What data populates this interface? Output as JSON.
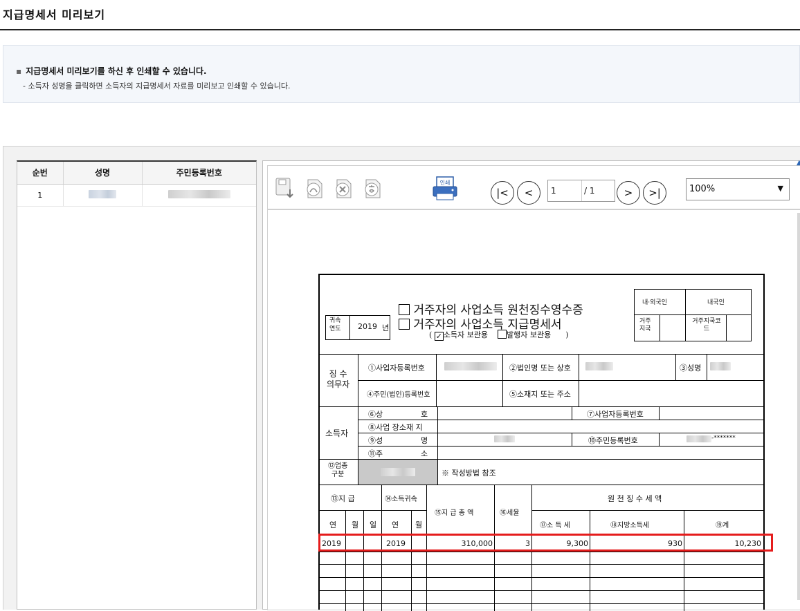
{
  "page": {
    "title": "지급명세서 미리보기"
  },
  "notice": {
    "bullet": "▪",
    "main": "지급명세서 미리보기를 하신 후 인쇄할 수 있습니다.",
    "sub": "- 소득자 성명을 클릭하면 소득자의 지급명세서 자료를 미리보고 인쇄할 수 있습니다."
  },
  "list": {
    "headers": [
      "순번",
      "성명",
      "주민등록번호"
    ],
    "rows": [
      {
        "no": "1",
        "name": "",
        "rrn": ""
      }
    ]
  },
  "toolbar": {
    "icons": [
      "save-icon",
      "pdf-icon",
      "excel-icon",
      "hwp-icon",
      "print-icon"
    ],
    "print_label": "인쇄",
    "first": "|<",
    "prev": "<",
    "next": ">",
    "last": ">|",
    "page_current": "1",
    "page_total": "/ 1",
    "zoom": "100%",
    "zoom_arrow": "▼"
  },
  "form": {
    "year_label": "귀속\n연도",
    "year_value": "2019",
    "year_unit": "년",
    "title1": "거주자의 사업소득 원천징수영수증",
    "title2": "거주자의 사업소득 지급명세서",
    "copy_open": "(",
    "copy_income": "소득자 보관용",
    "copy_payer": "발행자 보관용",
    "copy_close": ")",
    "nat_label": "내·외국인",
    "nat_value": "내국인",
    "res_label": "거주\n지국",
    "res_code_label": "거주지국코\n드",
    "payer_group": "징 수\n의무자",
    "f1": "①사업자등록번호",
    "f2": "②법인명 또는 상호",
    "f3": "③성명",
    "f4": "④주민(법인)등록번호",
    "f5": "⑤소재지 또는 주소",
    "earner_group": "소득자",
    "f6a": "⑥상",
    "f6b": "호",
    "f7": "⑦사업자등록번호",
    "f8": "⑧사업 장소재 지",
    "f9a": "⑨성",
    "f9b": "명",
    "f10": "⑩주민등록번호",
    "f10_mask": "-*******",
    "f11a": "⑪주",
    "f11b": "소",
    "biz_label": "⑫업종\n구분",
    "biz_note": "※ 작성방법 참조",
    "pay_date": "⑬지     급",
    "income_period": "⑭소득귀속",
    "pay_total": "⑮지 급 총 액",
    "tax_rate": "⑯세율",
    "withheld": "원  천  징  수  세  액",
    "y": "연",
    "m": "월",
    "d": "일",
    "income_tax": "⑰소 득 세",
    "local_tax": "⑱지방소득세",
    "sum": "⑲계",
    "row": {
      "pay_year": "2019",
      "attr_year": "2019",
      "total": "310,000",
      "rate": "3",
      "income_tax": "9,300",
      "local_tax": "930",
      "sum": "10,230"
    }
  }
}
